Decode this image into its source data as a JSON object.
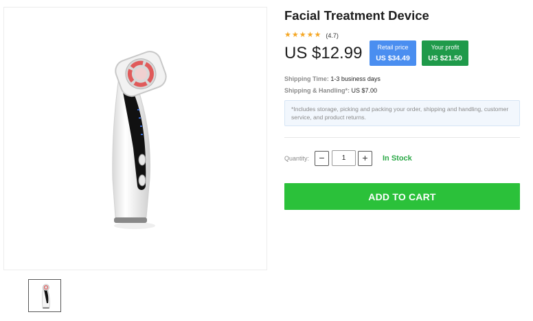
{
  "product": {
    "title": "Facial Treatment Device",
    "rating_value": "(4.7)",
    "star_count": 5,
    "price": "US $12.99"
  },
  "badges": {
    "retail_label": "Retail price",
    "retail_value": "US $34.49",
    "profit_label": "Your profit",
    "profit_value": "US $21.50"
  },
  "shipping": {
    "time_label": "Shipping Time:",
    "time_value": "1-3 business days",
    "handling_label": "Shipping & Handling*:",
    "handling_value": "US $7.00",
    "notice": "*Includes storage, picking and packing your order, shipping and handling, customer service, and product returns."
  },
  "quantity": {
    "label": "Quantity:",
    "minus": "−",
    "plus": "+",
    "value": "1",
    "stock": "In Stock"
  },
  "cart": {
    "button_label": "ADD TO CART"
  },
  "icons": {
    "star": "star-icon",
    "device": "facial-device-image"
  },
  "colors": {
    "retail_badge": "#4a8ef0",
    "profit_badge": "#1f9a4a",
    "cart_button": "#2bc13a",
    "in_stock": "#2aa846",
    "star": "#f5a623"
  }
}
